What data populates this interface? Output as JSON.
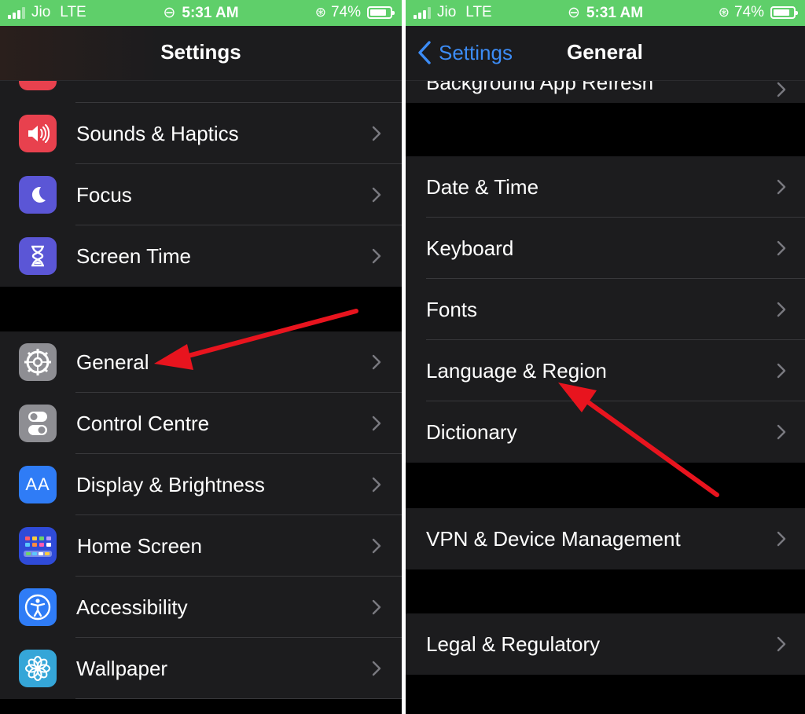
{
  "status": {
    "carrier": "Jio",
    "network": "LTE",
    "time": "5:31 AM",
    "battery": "74%",
    "battery_level": 0.74
  },
  "left": {
    "title": "Settings",
    "items": [
      {
        "label": "Sounds & Haptics",
        "icon": "speaker-icon",
        "color": "#e8414e"
      },
      {
        "label": "Focus",
        "icon": "moon-icon",
        "color": "#5b56d6"
      },
      {
        "label": "Screen Time",
        "icon": "hourglass-icon",
        "color": "#5b56d6"
      },
      {
        "label": "General",
        "icon": "gear-icon",
        "color": "#8e8e93"
      },
      {
        "label": "Control Centre",
        "icon": "toggles-icon",
        "color": "#8e8e93"
      },
      {
        "label": "Display & Brightness",
        "icon": "text-size-icon",
        "color": "#2f7cf6"
      },
      {
        "label": "Home Screen",
        "icon": "app-grid-icon",
        "color": "#2f4bd8"
      },
      {
        "label": "Accessibility",
        "icon": "accessibility-icon",
        "color": "#2f7cf6"
      },
      {
        "label": "Wallpaper",
        "icon": "flower-icon",
        "color": "#35a6d8"
      }
    ]
  },
  "right": {
    "back_label": "Settings",
    "title": "General",
    "partial_item": "Background App Refresh",
    "groups": [
      [
        "Date & Time",
        "Keyboard",
        "Fonts",
        "Language & Region",
        "Dictionary"
      ],
      [
        "VPN & Device Management"
      ],
      [
        "Legal & Regulatory"
      ]
    ]
  },
  "colors": {
    "statusbar": "#5fcf6a",
    "accent": "#3c8cf6",
    "arrow": "#e8141e"
  }
}
